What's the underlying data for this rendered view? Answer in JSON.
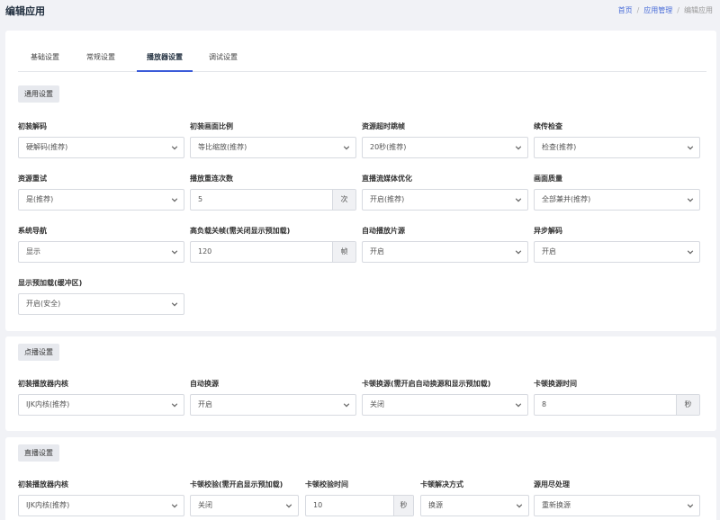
{
  "header": {
    "title": "编辑应用",
    "breadcrumb": {
      "home": "首页",
      "sep": "/",
      "app_manage": "应用管理",
      "current": "编辑应用"
    }
  },
  "tabs": [
    "基础设置",
    "常规设置",
    "播放器设置",
    "调试设置"
  ],
  "active_tab": "播放器设置",
  "colors": {
    "accent": "#3a5bd9",
    "page_bg": "#f1f2f6",
    "card_bg": "#ffffff",
    "link": "#4a6dd8"
  },
  "general": {
    "section_label": "通用设置",
    "fields": [
      {
        "label": "初装解码",
        "type": "select",
        "value": "硬解码(推荐)"
      },
      {
        "label": "初装画面比例",
        "type": "select",
        "value": "等比缩放(推荐)"
      },
      {
        "label": "资源超时跳帧",
        "type": "select",
        "value": "20秒(推荐)"
      },
      {
        "label": "续传检查",
        "type": "select",
        "value": "检查(推荐)"
      },
      {
        "label": "资源重试",
        "type": "select",
        "value": "是(推荐)"
      },
      {
        "label": "播放重连次数",
        "type": "input",
        "value": "5",
        "suffix": "次"
      },
      {
        "label": "直播流媒体优化",
        "type": "select",
        "value": "开启(推荐)"
      },
      {
        "label": "画面质量",
        "type": "select",
        "value": "全部兼并(推荐)"
      },
      {
        "label": "系统导航",
        "type": "select",
        "value": "显示"
      },
      {
        "label": "高负载关帧(需关闭显示预加载)",
        "type": "input",
        "value": "120",
        "suffix": "帧"
      },
      {
        "label": "自动播放片源",
        "type": "select",
        "value": "开启"
      },
      {
        "label": "异步解码",
        "type": "select",
        "value": "开启"
      },
      {
        "label": "显示预加载(缓冲区)",
        "type": "select",
        "value": "开启(安全)"
      }
    ]
  },
  "vod": {
    "section_label": "点播设置",
    "fields": [
      {
        "label": "初装播放器内核",
        "type": "select",
        "value": "IJK内核(推荐)"
      },
      {
        "label": "自动换源",
        "type": "select",
        "value": "开启"
      },
      {
        "label": "卡顿换源(需开启自动换源和显示预加载)",
        "type": "select",
        "value": "关闭"
      },
      {
        "label": "卡顿换源时间",
        "type": "input",
        "value": "8",
        "suffix": "秒"
      }
    ]
  },
  "live": {
    "section_label": "直播设置",
    "fields": [
      {
        "label": "初装播放器内核",
        "type": "select",
        "value": "IJK内核(推荐)"
      },
      {
        "label": "卡顿校验(需开启显示预加载)",
        "type": "select",
        "value": "关闭"
      },
      {
        "label": "卡顿校验时间",
        "type": "input",
        "value": "10",
        "suffix": "秒"
      },
      {
        "label": "卡顿解决方式",
        "type": "select",
        "value": "换源"
      },
      {
        "label": "源用尽处理",
        "type": "select",
        "value": "重新换源"
      }
    ]
  }
}
